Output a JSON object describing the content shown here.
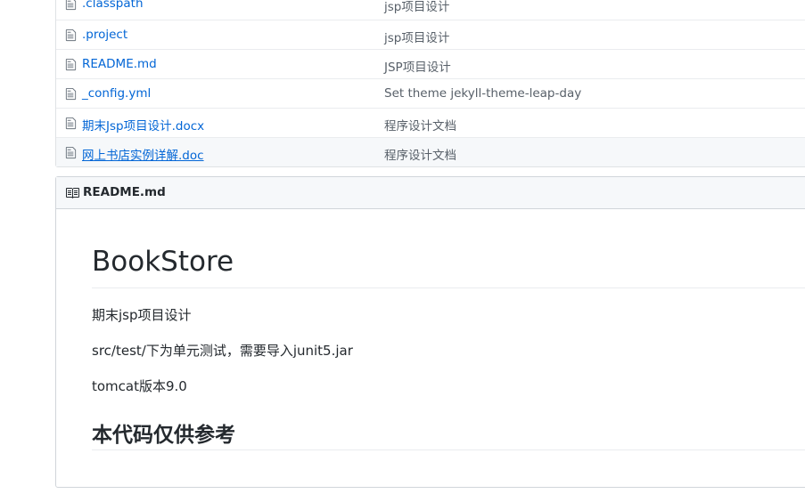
{
  "files": [
    {
      "name": ".classpath",
      "message": "jsp项目设计"
    },
    {
      "name": ".project",
      "message": "jsp项目设计"
    },
    {
      "name": "README.md",
      "message": "JSP项目设计"
    },
    {
      "name": "_config.yml",
      "message": "Set theme jekyll-theme-leap-day"
    },
    {
      "name": "期末Jsp项目设计.docx",
      "message": "程序设计文档"
    },
    {
      "name": "网上书店实例详解.doc",
      "message": "程序设计文档"
    }
  ],
  "readme": {
    "header_title": "README.md",
    "h1": "BookStore",
    "p1": "期末jsp项目设计",
    "p2": "src/test/下为单元测试，需要导入junit5.jar",
    "p3": "tomcat版本9.0",
    "h2": "本代码仅供参考"
  },
  "colors": {
    "link": "#0366d6",
    "muted": "#586069",
    "border": "#d1d5da",
    "header_bg": "#f6f8fa"
  },
  "icons": {
    "file": "file-text-icon",
    "readme": "book-icon"
  }
}
